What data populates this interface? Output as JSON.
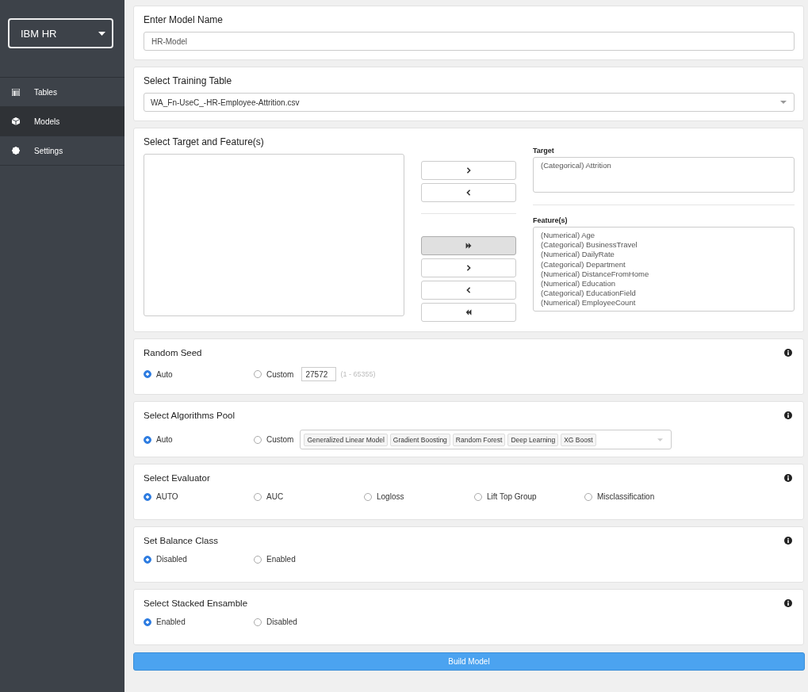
{
  "sidebar": {
    "workspace": "IBM HR",
    "items": [
      {
        "label": "Tables",
        "kind": "table",
        "selected": false
      },
      {
        "label": "Models",
        "kind": "cube",
        "selected": true
      },
      {
        "label": "Settings",
        "kind": "gear",
        "selected": false
      }
    ]
  },
  "model_name": {
    "title": "Enter Model Name",
    "value": "HR-Model"
  },
  "training_table": {
    "title": "Select Training Table",
    "value": "WA_Fn-UseC_-HR-Employee-Attrition.csv"
  },
  "target_features": {
    "title": "Select Target and Feature(s)",
    "target_buttons": [
      {
        "kind": "right",
        "active": false
      },
      {
        "kind": "left",
        "active": false
      }
    ],
    "feature_buttons": [
      {
        "kind": "all-right",
        "active": true
      },
      {
        "kind": "right",
        "active": false
      },
      {
        "kind": "left",
        "active": false
      },
      {
        "kind": "all-left",
        "active": false
      }
    ],
    "target_label": "Target",
    "target_items": [
      "(Categorical) Attrition"
    ],
    "features_label": "Feature(s)",
    "feature_items": [
      "(Numerical) Age",
      "(Categorical) BusinessTravel",
      "(Numerical) DailyRate",
      "(Categorical) Department",
      "(Numerical) DistanceFromHome",
      "(Numerical) Education",
      "(Categorical) EducationField",
      "(Numerical) EmployeeCount"
    ]
  },
  "option_sections": [
    {
      "title": "Random Seed",
      "options": [
        {
          "kind": "plain",
          "label": "Auto",
          "selected": true
        },
        {
          "kind": "seed",
          "label": "Custom",
          "selected": false,
          "value": "27572",
          "hint": "(1 - 65355)"
        }
      ]
    },
    {
      "title": "Select Algorithms Pool",
      "options": [
        {
          "kind": "plain",
          "label": "Auto",
          "selected": true
        },
        {
          "kind": "pool",
          "label": "Custom",
          "selected": false,
          "tags": [
            "Generalized Linear Model",
            "Gradient Boosting",
            "Random Forest",
            "Deep Learning",
            "XG Boost"
          ]
        }
      ]
    },
    {
      "title": "Select Evaluator",
      "options": [
        {
          "kind": "plain",
          "label": "AUTO",
          "selected": true
        },
        {
          "kind": "plain",
          "label": "AUC",
          "selected": false
        },
        {
          "kind": "plain",
          "label": "Logloss",
          "selected": false
        },
        {
          "kind": "plain",
          "label": "Lift Top Group",
          "selected": false
        },
        {
          "kind": "plain",
          "label": "Misclassification",
          "selected": false
        }
      ]
    },
    {
      "title": "Set Balance Class",
      "options": [
        {
          "kind": "plain",
          "label": "Disabled",
          "selected": true
        },
        {
          "kind": "plain",
          "label": "Enabled",
          "selected": false
        }
      ]
    },
    {
      "title": "Select Stacked Ensamble",
      "options": [
        {
          "kind": "plain",
          "label": "Enabled",
          "selected": true
        },
        {
          "kind": "plain",
          "label": "Disabled",
          "selected": false
        }
      ]
    }
  ],
  "build_button": "Build Model"
}
